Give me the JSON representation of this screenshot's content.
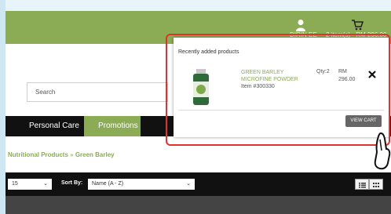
{
  "header": {
    "user_name": "DIRIN EE",
    "cart_summary": "2 item(s) - RM 296.00"
  },
  "search": {
    "placeholder": "Search"
  },
  "nav": {
    "items": [
      "Personal Care",
      "Promotions"
    ]
  },
  "breadcrumb": {
    "parent": "Nutritional Products",
    "separator": "»",
    "current": "Green Barley"
  },
  "toolbar": {
    "per_page": "15",
    "sort_label": "Sort By:",
    "sort_value": "Name (A - Z)"
  },
  "cart_popup": {
    "title": "Recently added products",
    "product_name": "GREEN BARLEY MICROFINE POWDER",
    "product_item": "Item #300330",
    "qty": "Qty:2",
    "currency": "RM",
    "price": "296.00",
    "view_cart_label": "VIEW CART"
  },
  "colors": {
    "brand_green": "#8bab55",
    "nav_dark": "#111111",
    "highlight_red": "#e0322e"
  },
  "icons": [
    "user-icon",
    "cart-icon",
    "close-icon",
    "chevron-down-icon",
    "list-view-icon",
    "grid-view-icon",
    "pointer-hand-icon"
  ]
}
